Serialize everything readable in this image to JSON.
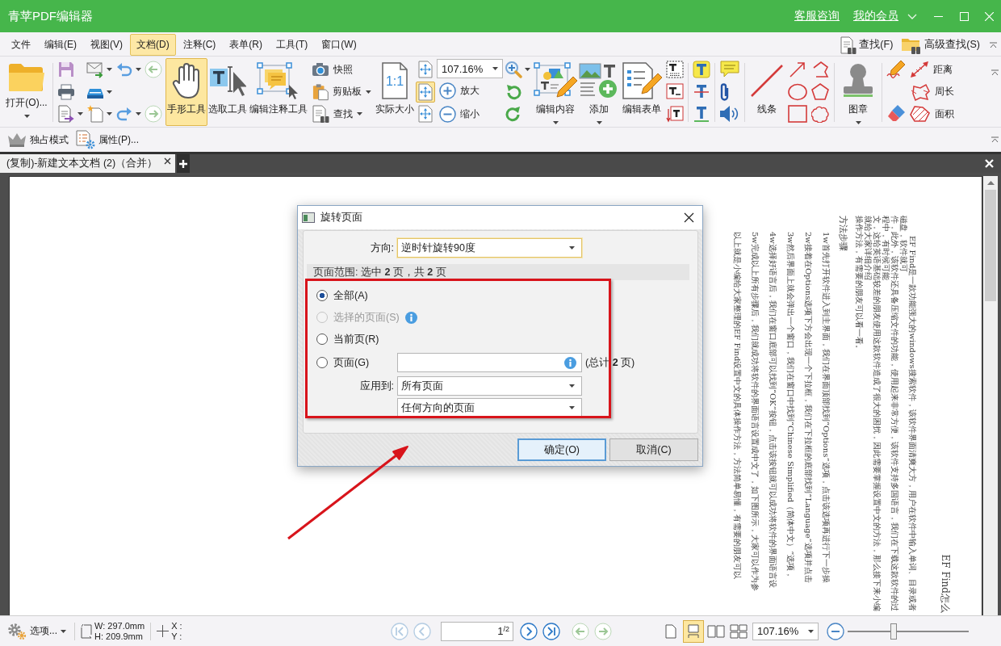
{
  "window": {
    "title": "青苹PDF编辑器",
    "links": [
      "客服咨询",
      "我的会员"
    ]
  },
  "menu": {
    "items": [
      {
        "label": "文件",
        "selected": false
      },
      {
        "label": "编辑(E)",
        "selected": false
      },
      {
        "label": "视图(V)",
        "selected": false
      },
      {
        "label": "文档(D)",
        "selected": true
      },
      {
        "label": "注释(C)",
        "selected": false
      },
      {
        "label": "表单(R)",
        "selected": false
      },
      {
        "label": "工具(T)",
        "selected": false
      },
      {
        "label": "窗口(W)",
        "selected": false
      }
    ],
    "find": [
      "查找(F)",
      "高级查找(S)"
    ]
  },
  "ribbon": {
    "open": "打开(O)...",
    "tools": [
      {
        "label": "手形工具",
        "selected": true
      },
      {
        "label": "选取工具",
        "selected": false
      },
      {
        "label": "编辑注释工具",
        "selected": false
      }
    ],
    "capture": [
      {
        "label": "快照",
        "dropdown": false
      },
      {
        "label": "剪贴板",
        "dropdown": true
      },
      {
        "label": "查找",
        "dropdown": true
      }
    ],
    "actual_size": {
      "label": "实际大小",
      "ratio": "1:1"
    },
    "fit_modes": [
      {
        "selected": false
      },
      {
        "selected": true
      },
      {
        "selected": false
      }
    ],
    "zoom": {
      "value": "107.16%"
    },
    "zoom_steps": [
      "放大",
      "缩小"
    ],
    "edit": [
      {
        "label": "编辑内容",
        "dropdown": true
      },
      {
        "label": "添加",
        "dropdown": true
      },
      {
        "label": "编辑表单",
        "dropdown": false
      }
    ],
    "lines": "线条",
    "stamp": "图章",
    "measure": [
      "距离",
      "周长",
      "面积"
    ]
  },
  "quickbar": [
    "独占模式",
    "属性(P)..."
  ],
  "tabs": [
    {
      "label": "(复制)-新建文本文档 (2)（合并）",
      "selected": true
    }
  ],
  "page": {
    "title": "EF Find怎么",
    "intro": [
      "EF Find是一款功能强大的windows搜索软件，该软件界面清爽大方，用户在软件中输入单词、目录或者磁盘，软件就可",
      "件，此外，该软件还具备压缩文件的功能，使用起来非常方便，该软件支持多国语言，我们在下载这款软件的过程中，有时候可能",
      "文，这给英语基础较差的朋友使用这款软件造成了很大的困扰，因此需要掌握设置中文的方法，那么接下来小编就给大家详细介绍",
      "操作方法，有需要的朋友可以看一看。"
    ],
    "heading": "方法步骤",
    "steps": [
      "1w首先打开软件进入到主界面，我们在界面顶部找到“Options”选项，点击该选项再进行下一步操",
      "2w接着在Options选项下方会出现一个下拉框，我们在下拉框的底部找到“Language”选项并点击",
      "3w然后界面上就会弹出一个窗口，我们在窗口中找到“Chinese Simplified（简体中文）”选项，",
      "4w选择好语言后，我们在窗口底部可以找到“OK”按钮，点击该按钮就可以成功将软件的界面语言设",
      "5w完成以上所有步骤后，我们就成功将软件的界面语言设置成中文了，如下图所示，大家可以作为参",
      "以上就是小编给大家整理的EF Find设置中文的具体操作方法，方法简单易懂，有需要的朋友可以"
    ]
  },
  "dialog": {
    "title": "旋转页面",
    "direction": {
      "label": "方向:",
      "value": "逆时针旋转90度"
    },
    "range": "页面范围: 选中 **2** 页，共 **2** 页",
    "options": [
      {
        "kind": "plain",
        "label": "全部(A)",
        "selected": true,
        "disabled": false,
        "info": false
      },
      {
        "kind": "plain",
        "label": "选择的页面(S)",
        "selected": false,
        "disabled": true,
        "info": true
      },
      {
        "kind": "plain",
        "label": "当前页(R)",
        "selected": false,
        "disabled": false,
        "info": false
      },
      {
        "kind": "field",
        "label": "页面(G)",
        "selected": false,
        "disabled": false,
        "info": false,
        "total": "(总计 **2** 页)"
      }
    ],
    "apply_to": {
      "label": "应用到:",
      "value": "所有页面"
    },
    "orientation": {
      "value": "任何方向的页面"
    },
    "buttons": [
      {
        "label": "确定(O)",
        "default": true
      },
      {
        "label": "取消(C)",
        "default": false
      }
    ]
  },
  "status": {
    "options": "选项...",
    "size": [
      "W: 297.0mm",
      "H: 209.9mm"
    ],
    "cursor": [
      "X :",
      "Y :"
    ],
    "nav": [
      {
        "disabled": true
      },
      {
        "disabled": true
      },
      {
        "disabled": false
      },
      {
        "disabled": false
      }
    ],
    "page": "1",
    "page_total": "/2",
    "view_modes": [
      {
        "selected": false
      },
      {
        "selected": true
      },
      {
        "selected": false
      },
      {
        "selected": false
      }
    ],
    "zoom": "107.16%",
    "zoom_slider": {
      "level": 0.38
    }
  }
}
